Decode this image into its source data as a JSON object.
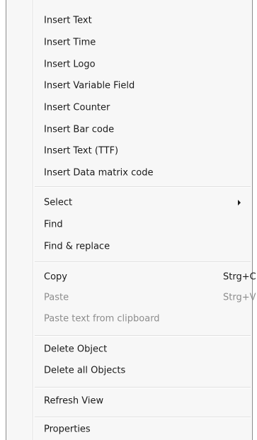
{
  "menu": {
    "items": [
      {
        "label": "Insert Text"
      },
      {
        "label": "Insert Time"
      },
      {
        "label": "Insert Logo"
      },
      {
        "label": "Insert Variable Field"
      },
      {
        "label": "Insert Counter"
      },
      {
        "label": "Insert Bar code"
      },
      {
        "label": "Insert Text (TTF)"
      },
      {
        "label": "Insert Data matrix code"
      },
      {
        "label": "Select"
      },
      {
        "label": "Find"
      },
      {
        "label": "Find & replace"
      },
      {
        "label": "Copy",
        "shortcut": "Strg+C"
      },
      {
        "label": "Paste",
        "shortcut": "Strg+V"
      },
      {
        "label": "Paste text from clipboard"
      },
      {
        "label": "Delete Object"
      },
      {
        "label": "Delete all Objects"
      },
      {
        "label": "Refresh View"
      },
      {
        "label": "Properties"
      }
    ]
  },
  "icons": {
    "submenu": "chevron-right-icon"
  },
  "colors": {
    "background": "#f7f7f7",
    "text": "#1a1a1a",
    "disabled_text": "#8d8d8d",
    "separator": "#e0e0e0",
    "border": "#8c8c8c"
  }
}
